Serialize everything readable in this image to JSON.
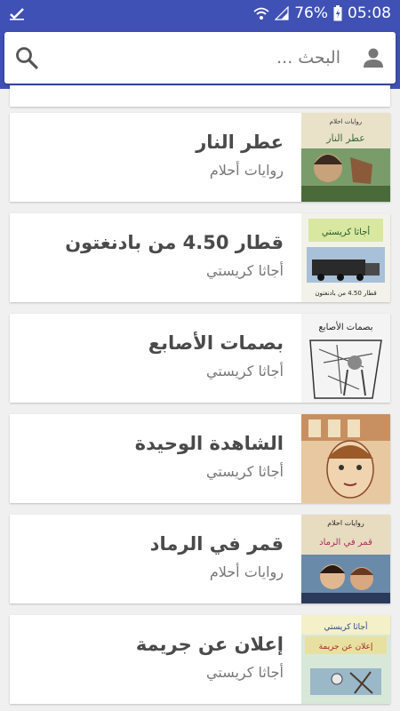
{
  "status_bar": {
    "battery": "76%",
    "time": "05:08",
    "bg_color": "#3f51b5"
  },
  "search": {
    "placeholder": "البحث ..."
  },
  "books": [
    {
      "title": "عطر النار",
      "author": "روايات أحلام",
      "cover_label": "روايات احلام",
      "cover_title": "عطر النار"
    },
    {
      "title": "قطار 4.50 من بادنغتون",
      "author": "أجاثا كريستي",
      "cover_label": "أجاثا كريستي",
      "cover_title": "قطار 4.50 من بادنغتون"
    },
    {
      "title": "بصمات الأصابع",
      "author": "أجاثا كريستي",
      "cover_label": "",
      "cover_title": "بصمات الأصابع"
    },
    {
      "title": "الشاهدة الوحيدة",
      "author": "أجاثا كريستي",
      "cover_label": "",
      "cover_title": ""
    },
    {
      "title": "قمر في الرماد",
      "author": "روايات أحلام",
      "cover_label": "روايات احلام",
      "cover_title": "قمر في الرماد"
    },
    {
      "title": "إعلان عن جريمة",
      "author": "أجاثا كريستي",
      "cover_label": "أجاثا كريستي",
      "cover_title": "إعلان عن جريمة"
    }
  ]
}
